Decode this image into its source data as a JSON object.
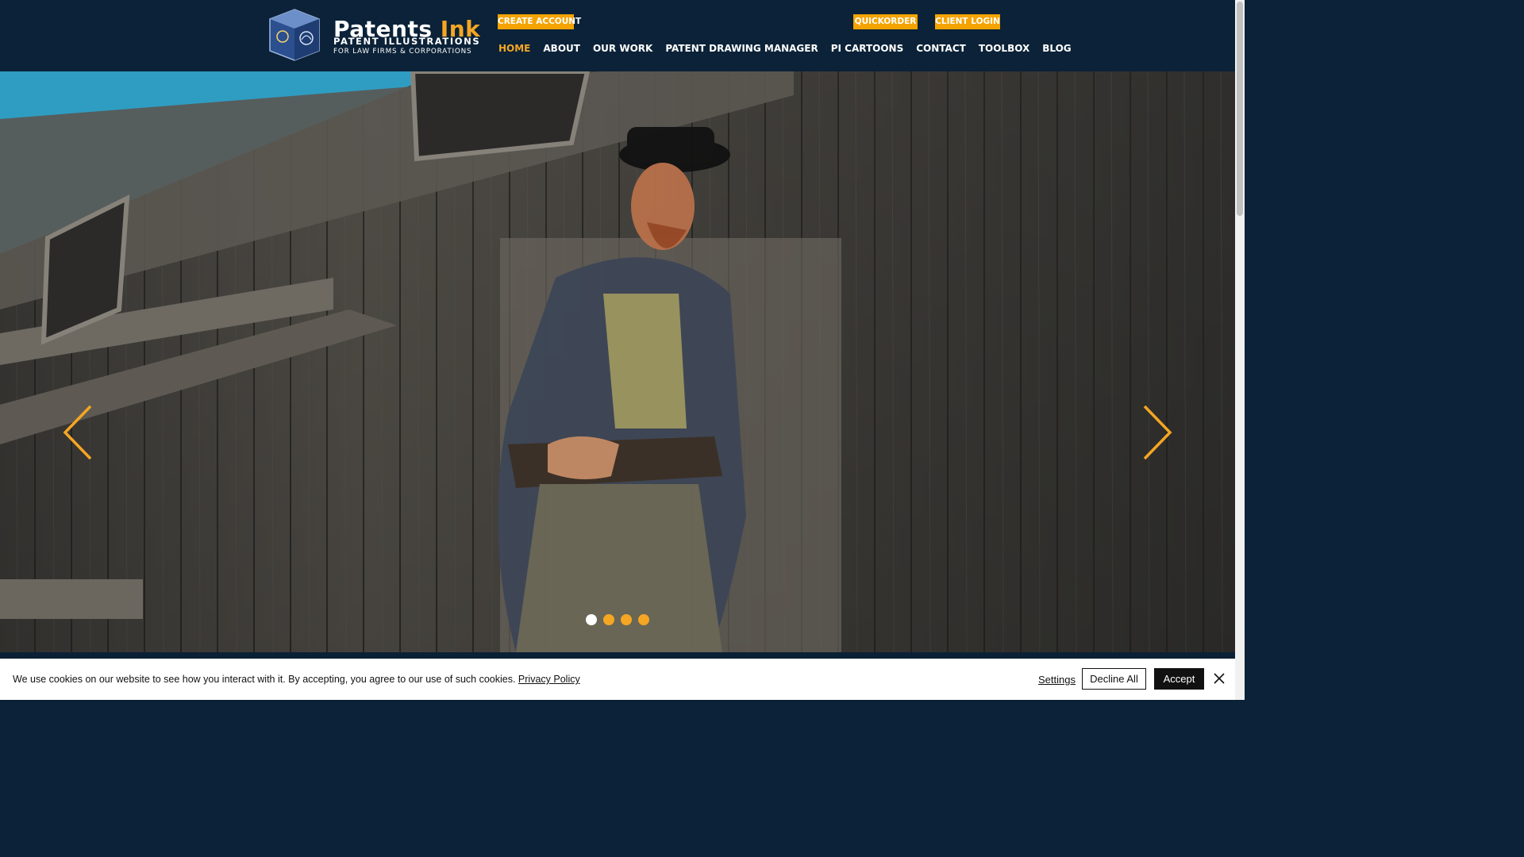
{
  "header": {
    "logo": {
      "title_main": "Patents ",
      "title_accent": "Ink",
      "subtitle_1": "PATENT ILLUSTRATIONS",
      "subtitle_2": "FOR LAW FIRMS & CORPORATIONS"
    },
    "buttons": {
      "create_account": "CREATE ACCOUNT",
      "quickorder": "QUICKORDER",
      "client_login": "CLIENT LOGIN"
    },
    "nav": [
      {
        "label": "HOME",
        "active": true
      },
      {
        "label": "ABOUT",
        "active": false
      },
      {
        "label": "OUR WORK",
        "active": false
      },
      {
        "label": "PATENT DRAWING MANAGER",
        "active": false
      },
      {
        "label": "PI CARTOONS",
        "active": false
      },
      {
        "label": "CONTACT",
        "active": false
      },
      {
        "label": "TOOLBOX",
        "active": false
      },
      {
        "label": "BLOG",
        "active": false
      }
    ]
  },
  "hero": {
    "slides_total": 4,
    "active_slide": 1,
    "prev_icon": "chevron-left-icon",
    "next_icon": "chevron-right-icon"
  },
  "cookie_banner": {
    "text": "We use cookies on our website to see how you interact with it. By accepting, you agree to our use of such cookies. ",
    "privacy_link": "Privacy Policy",
    "settings": "Settings",
    "decline": "Decline All",
    "accept": "Accept"
  },
  "colors": {
    "header_bg": "#0b2238",
    "accent": "#f5a623",
    "button_orange": "#f5a300"
  }
}
